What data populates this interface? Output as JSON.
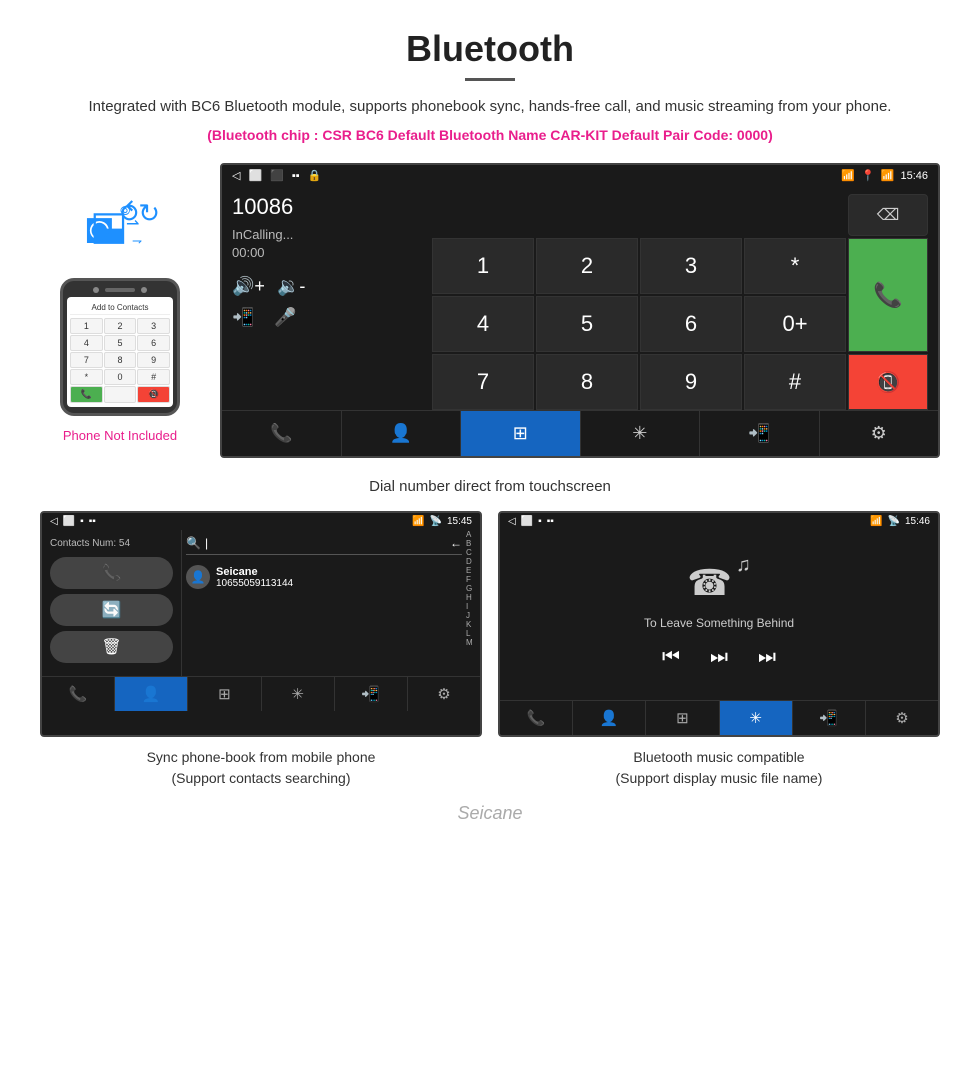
{
  "header": {
    "title": "Bluetooth",
    "description": "Integrated with BC6 Bluetooth module, supports phonebook sync, hands-free call, and music streaming from your phone.",
    "spec_line": "(Bluetooth chip : CSR BC6    Default Bluetooth Name CAR-KIT    Default Pair Code: 0000)"
  },
  "phone_left": {
    "not_included": "Phone Not Included",
    "screen_label": "Add to Contacts"
  },
  "car_screen": {
    "status_time": "15:46",
    "dial_number": "10086",
    "call_status": "InCalling...",
    "call_timer": "00:00",
    "numpad": [
      "1",
      "2",
      "3",
      "*",
      "4",
      "5",
      "6",
      "0+",
      "7",
      "8",
      "9",
      "#"
    ],
    "backspace": "⌫",
    "bottom_buttons": [
      "📞↗",
      "👤",
      "⊞",
      "🔵+",
      "📲",
      "⚙"
    ]
  },
  "caption_main": "Dial number direct from touchscreen",
  "contacts_screen": {
    "status_time": "15:45",
    "contacts_count": "Contacts Num: 54",
    "contact_name": "Seicane",
    "contact_number": "10655059113144",
    "alphabet": [
      "A",
      "B",
      "C",
      "D",
      "E",
      "F",
      "G",
      "H",
      "I",
      "J",
      "K",
      "L",
      "M"
    ],
    "bottom_buttons": [
      "📞↗",
      "👤",
      "⊞",
      "🔵+",
      "📲",
      "⚙"
    ]
  },
  "music_screen": {
    "status_time": "15:46",
    "song_title": "To Leave Something Behind",
    "bottom_buttons": [
      "📞↗",
      "👤",
      "⊞",
      "🔵+",
      "📲",
      "⚙"
    ]
  },
  "caption_contacts": {
    "line1": "Sync phone-book from mobile phone",
    "line2": "(Support contacts searching)"
  },
  "caption_music": {
    "line1": "Bluetooth music compatible",
    "line2": "(Support display music file name)"
  },
  "watermark": "Seicane"
}
